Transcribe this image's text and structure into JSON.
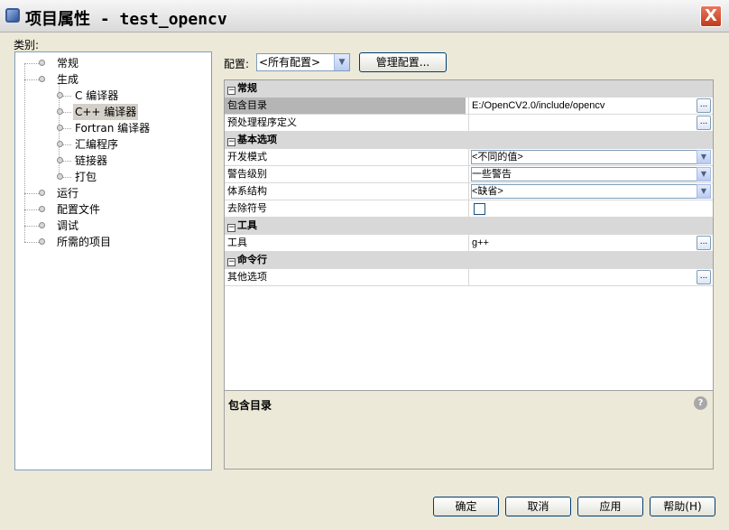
{
  "window": {
    "title": "项目属性 - test_opencv",
    "close_label": "X"
  },
  "category_label": "类别:",
  "tree": {
    "items": [
      {
        "label": "常规"
      },
      {
        "label": "生成"
      },
      {
        "label": "C 编译器"
      },
      {
        "label": "C++ 编译器",
        "selected": true
      },
      {
        "label": "Fortran 编译器"
      },
      {
        "label": "汇编程序"
      },
      {
        "label": "链接器"
      },
      {
        "label": "打包"
      },
      {
        "label": "运行"
      },
      {
        "label": "配置文件"
      },
      {
        "label": "调试"
      },
      {
        "label": "所需的项目"
      }
    ]
  },
  "config": {
    "label": "配置:",
    "selected": "<所有配置>",
    "manage_button": "管理配置..."
  },
  "properties": {
    "cat_general": "常规",
    "include_dirs": {
      "name": "包含目录",
      "value": "E:/OpenCV2.0/include/opencv"
    },
    "preproc_defs": {
      "name": "预处理程序定义",
      "value": ""
    },
    "cat_basic": "基本选项",
    "dev_mode": {
      "name": "开发模式",
      "value": "<不同的值>"
    },
    "warn_level": {
      "name": "警告级别",
      "value": "一些警告"
    },
    "arch": {
      "name": "体系结构",
      "value": "<缺省>"
    },
    "strip_symbols": {
      "name": "去除符号",
      "checked": false
    },
    "cat_tools": "工具",
    "tool": {
      "name": "工具",
      "value": "g++"
    },
    "cat_cmdline": "命令行",
    "other_opts": {
      "name": "其他选项",
      "value": ""
    },
    "ellipsis": "...",
    "minus": "−"
  },
  "description": {
    "title": "包含目录",
    "help_glyph": "?"
  },
  "buttons": {
    "ok": "确定",
    "cancel": "取消",
    "apply": "应用",
    "help": "帮助(H)"
  },
  "icons": {
    "dropdown": "▼"
  }
}
